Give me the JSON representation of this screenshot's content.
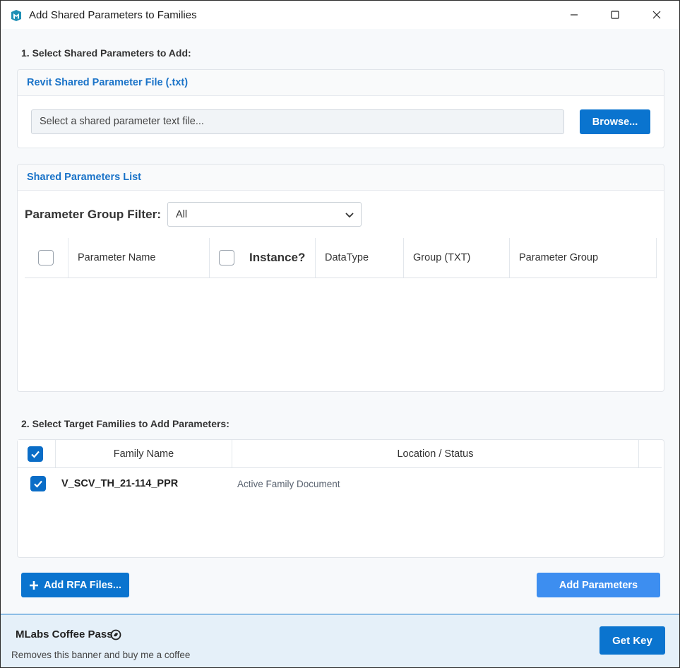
{
  "window": {
    "title": "Add Shared Parameters to Families"
  },
  "step1": {
    "heading": "1. Select Shared Parameters to Add:"
  },
  "file_panel": {
    "header": "Revit Shared Parameter File (.txt)",
    "file_input_placeholder": "Select a shared parameter text file...",
    "browse_label": "Browse..."
  },
  "params_panel": {
    "header": "Shared Parameters List",
    "filter_label": "Parameter Group Filter:",
    "filter_selected": "All",
    "columns": {
      "name": "Parameter Name",
      "instance": "Instance?",
      "datatype": "DataType",
      "group_txt": "Group (TXT)",
      "param_group": "Parameter Group"
    },
    "rows": []
  },
  "step2": {
    "heading": "2. Select Target Families to Add Parameters:"
  },
  "families_panel": {
    "columns": {
      "family_name": "Family Name",
      "location_status": "Location / Status"
    },
    "rows": [
      {
        "checked": true,
        "name": "V_SCV_TH_21-114_PPR",
        "status": "Active Family Document"
      }
    ]
  },
  "actions": {
    "add_rfa_label": "Add RFA Files...",
    "add_parameters_label": "Add Parameters"
  },
  "banner": {
    "title": "MLabs Coffee Pass",
    "subtitle": "Removes this banner and buy me a coffee",
    "get_key_label": "Get Key"
  },
  "colors": {
    "accent": "#0a74cf",
    "add_parameters_button": "#3d8ef0",
    "banner_bg": "#e5f0f9",
    "header_text": "#1a73c8"
  }
}
